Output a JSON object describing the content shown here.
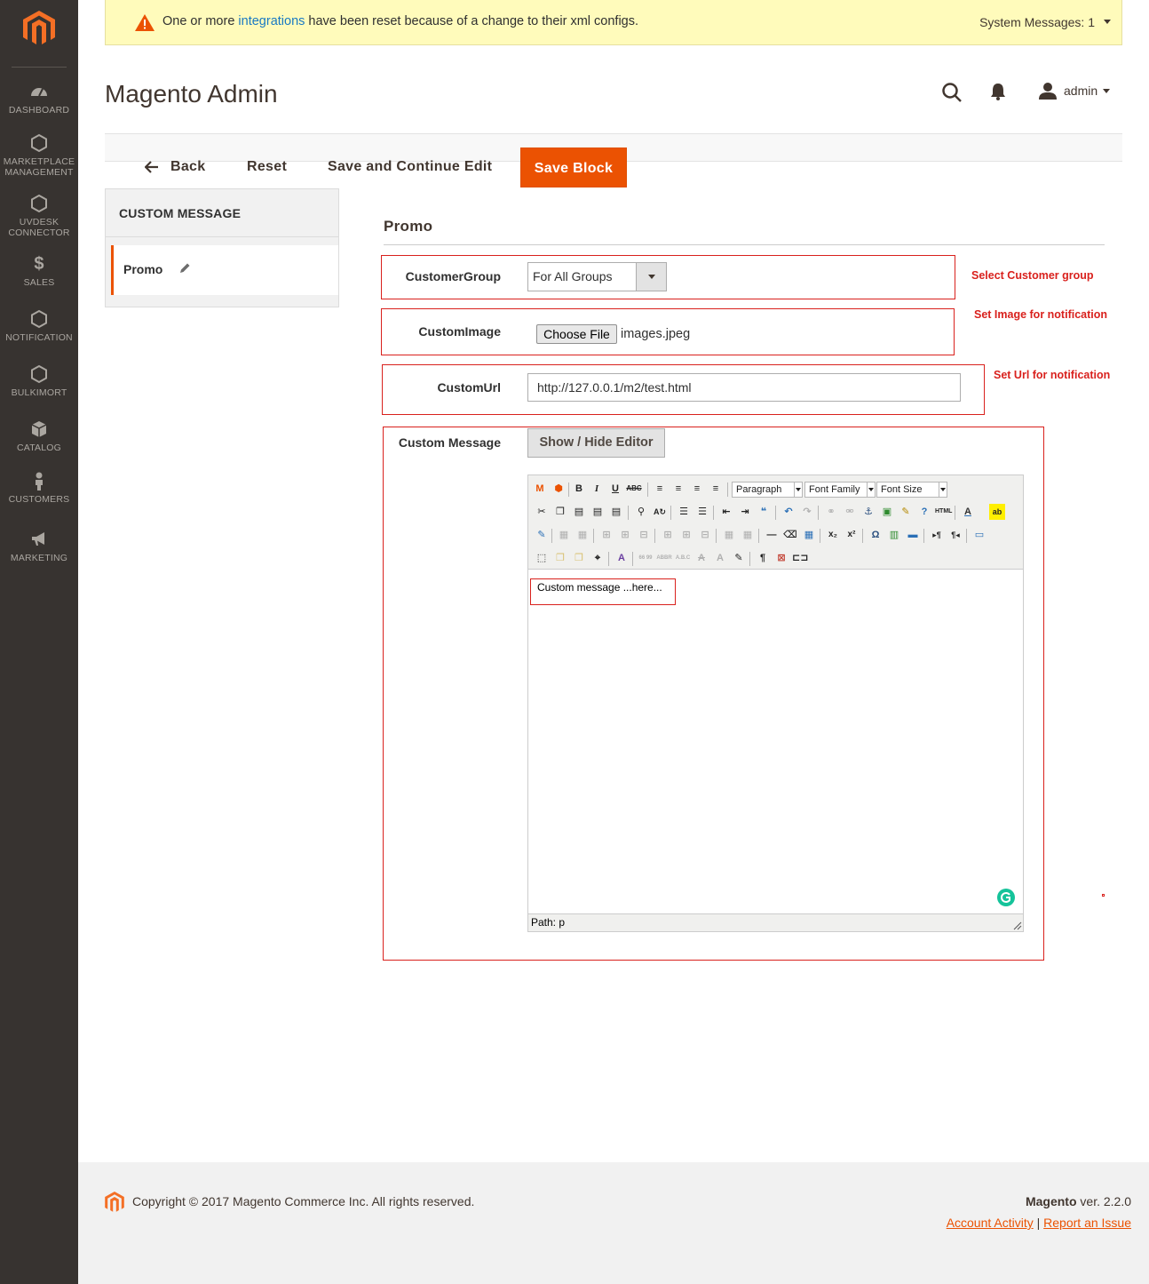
{
  "sidebar": {
    "items": [
      {
        "label": "DASHBOARD",
        "icon": "dashboard-icon"
      },
      {
        "label": "MARKETPLACE MANAGEMENT",
        "line1": "MARKETPLACE",
        "line2": "MANAGEMENT",
        "icon": "hexagon-icon"
      },
      {
        "label": "UVDESK CONNECTOR",
        "line1": "UVDESK",
        "line2": "CONNECTOR",
        "icon": "hexagon-icon"
      },
      {
        "label": "SALES",
        "icon": "dollar-icon"
      },
      {
        "label": "NOTIFICATION",
        "icon": "hexagon-icon"
      },
      {
        "label": "BULKIMORT",
        "icon": "hexagon-icon"
      },
      {
        "label": "CATALOG",
        "icon": "box-icon"
      },
      {
        "label": "CUSTOMERS",
        "icon": "person-icon"
      },
      {
        "label": "MARKETING",
        "icon": "megaphone-icon"
      }
    ]
  },
  "notice": {
    "before": "One or more ",
    "link": "integrations",
    "after": " have been reset because of a change to their xml configs.",
    "system_messages": "System Messages: 1"
  },
  "header": {
    "title": "Magento Admin",
    "user": "admin"
  },
  "actions": {
    "back": "Back",
    "reset": "Reset",
    "save_continue": "Save and Continue Edit",
    "save": "Save Block"
  },
  "tabs": {
    "heading": "CUSTOM MESSAGE",
    "items": [
      {
        "label": "Promo"
      }
    ]
  },
  "section": {
    "title": "Promo"
  },
  "form": {
    "customer_group": {
      "label": "CustomerGroup",
      "value": "For All Groups"
    },
    "custom_image": {
      "label": "CustomImage",
      "button": "Choose File",
      "file": "images.jpeg"
    },
    "custom_url": {
      "label": "CustomUrl",
      "value": "http://127.0.0.1/m2/test.html"
    },
    "custom_message": {
      "label": "Custom Message",
      "toggle": "Show / Hide Editor"
    }
  },
  "notes": {
    "group": "Select Customer group",
    "image": "Set Image for notification",
    "url": "Set Url for notification"
  },
  "editor": {
    "paragraph": "Paragraph",
    "font_family": "Font Family",
    "font_size": "Font Size",
    "content": "Custom message ...here...",
    "path": "Path: p"
  },
  "footer": {
    "copyright": "Copyright © 2017 Magento Commerce Inc. All rights reserved.",
    "brand": "Magento",
    "version": " ver. 2.2.0",
    "account_activity": "Account Activity",
    "report_issue": "Report an Issue",
    "separator": " | "
  },
  "colors": {
    "accent": "#eb5202",
    "sidebar": "#373330",
    "annotation": "#d9211d",
    "link": "#1979c3"
  }
}
